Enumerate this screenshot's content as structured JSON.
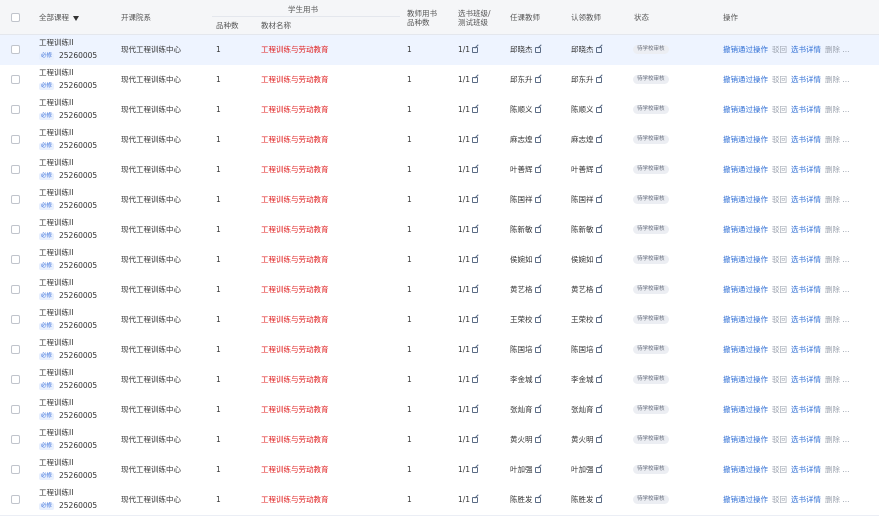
{
  "header": {
    "course": "全部课程",
    "dept": "开课院系",
    "student_books": "学生用书",
    "kinds": "品种数",
    "textbook": "教材名称",
    "teacher_books_line1": "教师用书",
    "teacher_books_line2": "品种数",
    "class_line1": "选书班级/",
    "class_line2": "测试班级",
    "teacher": "任课教师",
    "auth_teacher": "认领教师",
    "status": "状态",
    "ops": "操作"
  },
  "row_common": {
    "course_name": "工程训练II",
    "tag": "必修",
    "code": "25260005",
    "dept": "现代工程训练中心",
    "kinds": "1",
    "textbook": "工程训练与劳动教育",
    "teacher_kinds": "1",
    "classes": "1/1",
    "status": "待学校审核",
    "op_revoke": "撤销通过操作",
    "op_reject": "驳回",
    "op_detail": "选书详情",
    "op_delete": "删除 ..."
  },
  "rows": [
    {
      "teacher": "邱晓杰",
      "auth": "邱晓杰"
    },
    {
      "teacher": "邱东升",
      "auth": "邱东升"
    },
    {
      "teacher": "陈顺义",
      "auth": "陈顺义"
    },
    {
      "teacher": "麻志煌",
      "auth": "麻志煌"
    },
    {
      "teacher": "叶善辉",
      "auth": "叶善辉"
    },
    {
      "teacher": "陈国祥",
      "auth": "陈国祥"
    },
    {
      "teacher": "陈新敏",
      "auth": "陈新敏"
    },
    {
      "teacher": "侯婉如",
      "auth": "侯婉如"
    },
    {
      "teacher": "黄艺格",
      "auth": "黄艺格"
    },
    {
      "teacher": "王荣校",
      "auth": "王荣校"
    },
    {
      "teacher": "陈国培",
      "auth": "陈国培"
    },
    {
      "teacher": "李金城",
      "auth": "李金城"
    },
    {
      "teacher": "张灿育",
      "auth": "张灿育"
    },
    {
      "teacher": "黄火明",
      "auth": "黄火明"
    },
    {
      "teacher": "叶加强",
      "auth": "叶加强"
    },
    {
      "teacher": "陈胜发",
      "auth": "陈胜发"
    }
  ]
}
